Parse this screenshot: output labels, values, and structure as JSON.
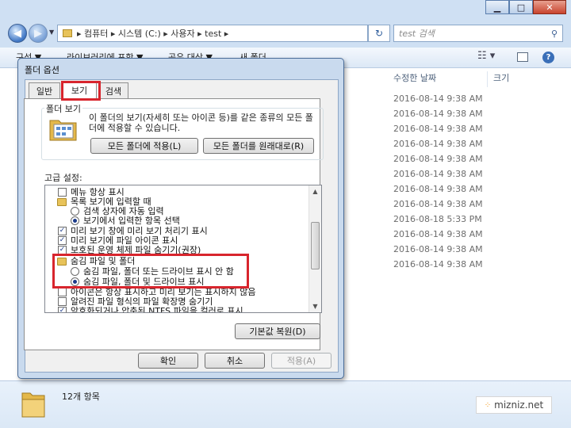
{
  "explorer": {
    "breadcrumb": [
      "컴퓨터",
      "시스템 (C:)",
      "사용자",
      "test"
    ],
    "search_placeholder": "test 검색",
    "toolbar": [
      "구성 ▼",
      "라이브러리에 포함 ▼",
      "공유 대상 ▼",
      "새 폴더"
    ],
    "columns": [
      "수정한 날짜",
      "크기"
    ],
    "dates": [
      "2016-08-14 9:38 AM",
      "2016-08-14 9:38 AM",
      "2016-08-14 9:38 AM",
      "2016-08-14 9:38 AM",
      "2016-08-14 9:38 AM",
      "2016-08-14 9:38 AM",
      "2016-08-14 9:38 AM",
      "2016-08-14 9:38 AM",
      "2016-08-18 5:33 PM",
      "2016-08-14 9:38 AM",
      "2016-08-14 9:38 AM",
      "2016-08-14 9:38 AM"
    ],
    "status_count": "12개 항목",
    "watermark": "mizniz.net"
  },
  "dialog": {
    "title": "폴더 옵션",
    "tabs": [
      "일반",
      "보기",
      "검색"
    ],
    "folder_view": {
      "legend": "폴더 보기",
      "description": "이 폴더의 보기(자세히 또는 아이콘 등)를 같은 종류의 모든 폴더에 적용할 수 있습니다.",
      "apply_button": "모든 폴더에 적용(L)",
      "reset_button": "모든 폴더를 원래대로(R)"
    },
    "advanced_label": "고급 설정:",
    "settings": [
      {
        "kind": "check",
        "checked": false,
        "level": 1,
        "label": "메뉴 항상 표시"
      },
      {
        "kind": "folder",
        "level": 1,
        "label": "목록 보기에 입력할 때"
      },
      {
        "kind": "radio",
        "checked": false,
        "level": 2,
        "label": "검색 상자에 자동 입력"
      },
      {
        "kind": "radio",
        "checked": true,
        "level": 2,
        "label": "보기에서 입력한 항목 선택"
      },
      {
        "kind": "check",
        "checked": true,
        "level": 1,
        "label": "미리 보기 창에 미리 보기 처리기 표시"
      },
      {
        "kind": "check",
        "checked": true,
        "level": 1,
        "label": "미리 보기에 파일 아이콘 표시"
      },
      {
        "kind": "check",
        "checked": true,
        "level": 1,
        "label": "보호된 운영 체제 파일 숨기기(권장)"
      },
      {
        "kind": "folder",
        "level": 1,
        "label": "숨김 파일 및 폴더"
      },
      {
        "kind": "radio",
        "checked": false,
        "level": 2,
        "label": "숨김 파일, 폴더 또는 드라이브 표시 안 함"
      },
      {
        "kind": "radio",
        "checked": true,
        "level": 2,
        "label": "숨김 파일, 폴더 및 드라이브 표시"
      },
      {
        "kind": "check",
        "checked": false,
        "level": 1,
        "label": "아이콘은 항상 표시하고 미리 보기는 표시하지 않음"
      },
      {
        "kind": "check",
        "checked": false,
        "level": 1,
        "label": "알려진 파일 형식의 파일 확장명 숨기기"
      },
      {
        "kind": "check",
        "checked": true,
        "level": 1,
        "label": "암호화되거나 압축된 NTFS 파일을 컬러로 표시"
      }
    ],
    "restore_button": "기본값 복원(D)",
    "ok_button": "확인",
    "cancel_button": "취소",
    "apply_button": "적용(A)"
  },
  "highlight_color": "#d8252d"
}
